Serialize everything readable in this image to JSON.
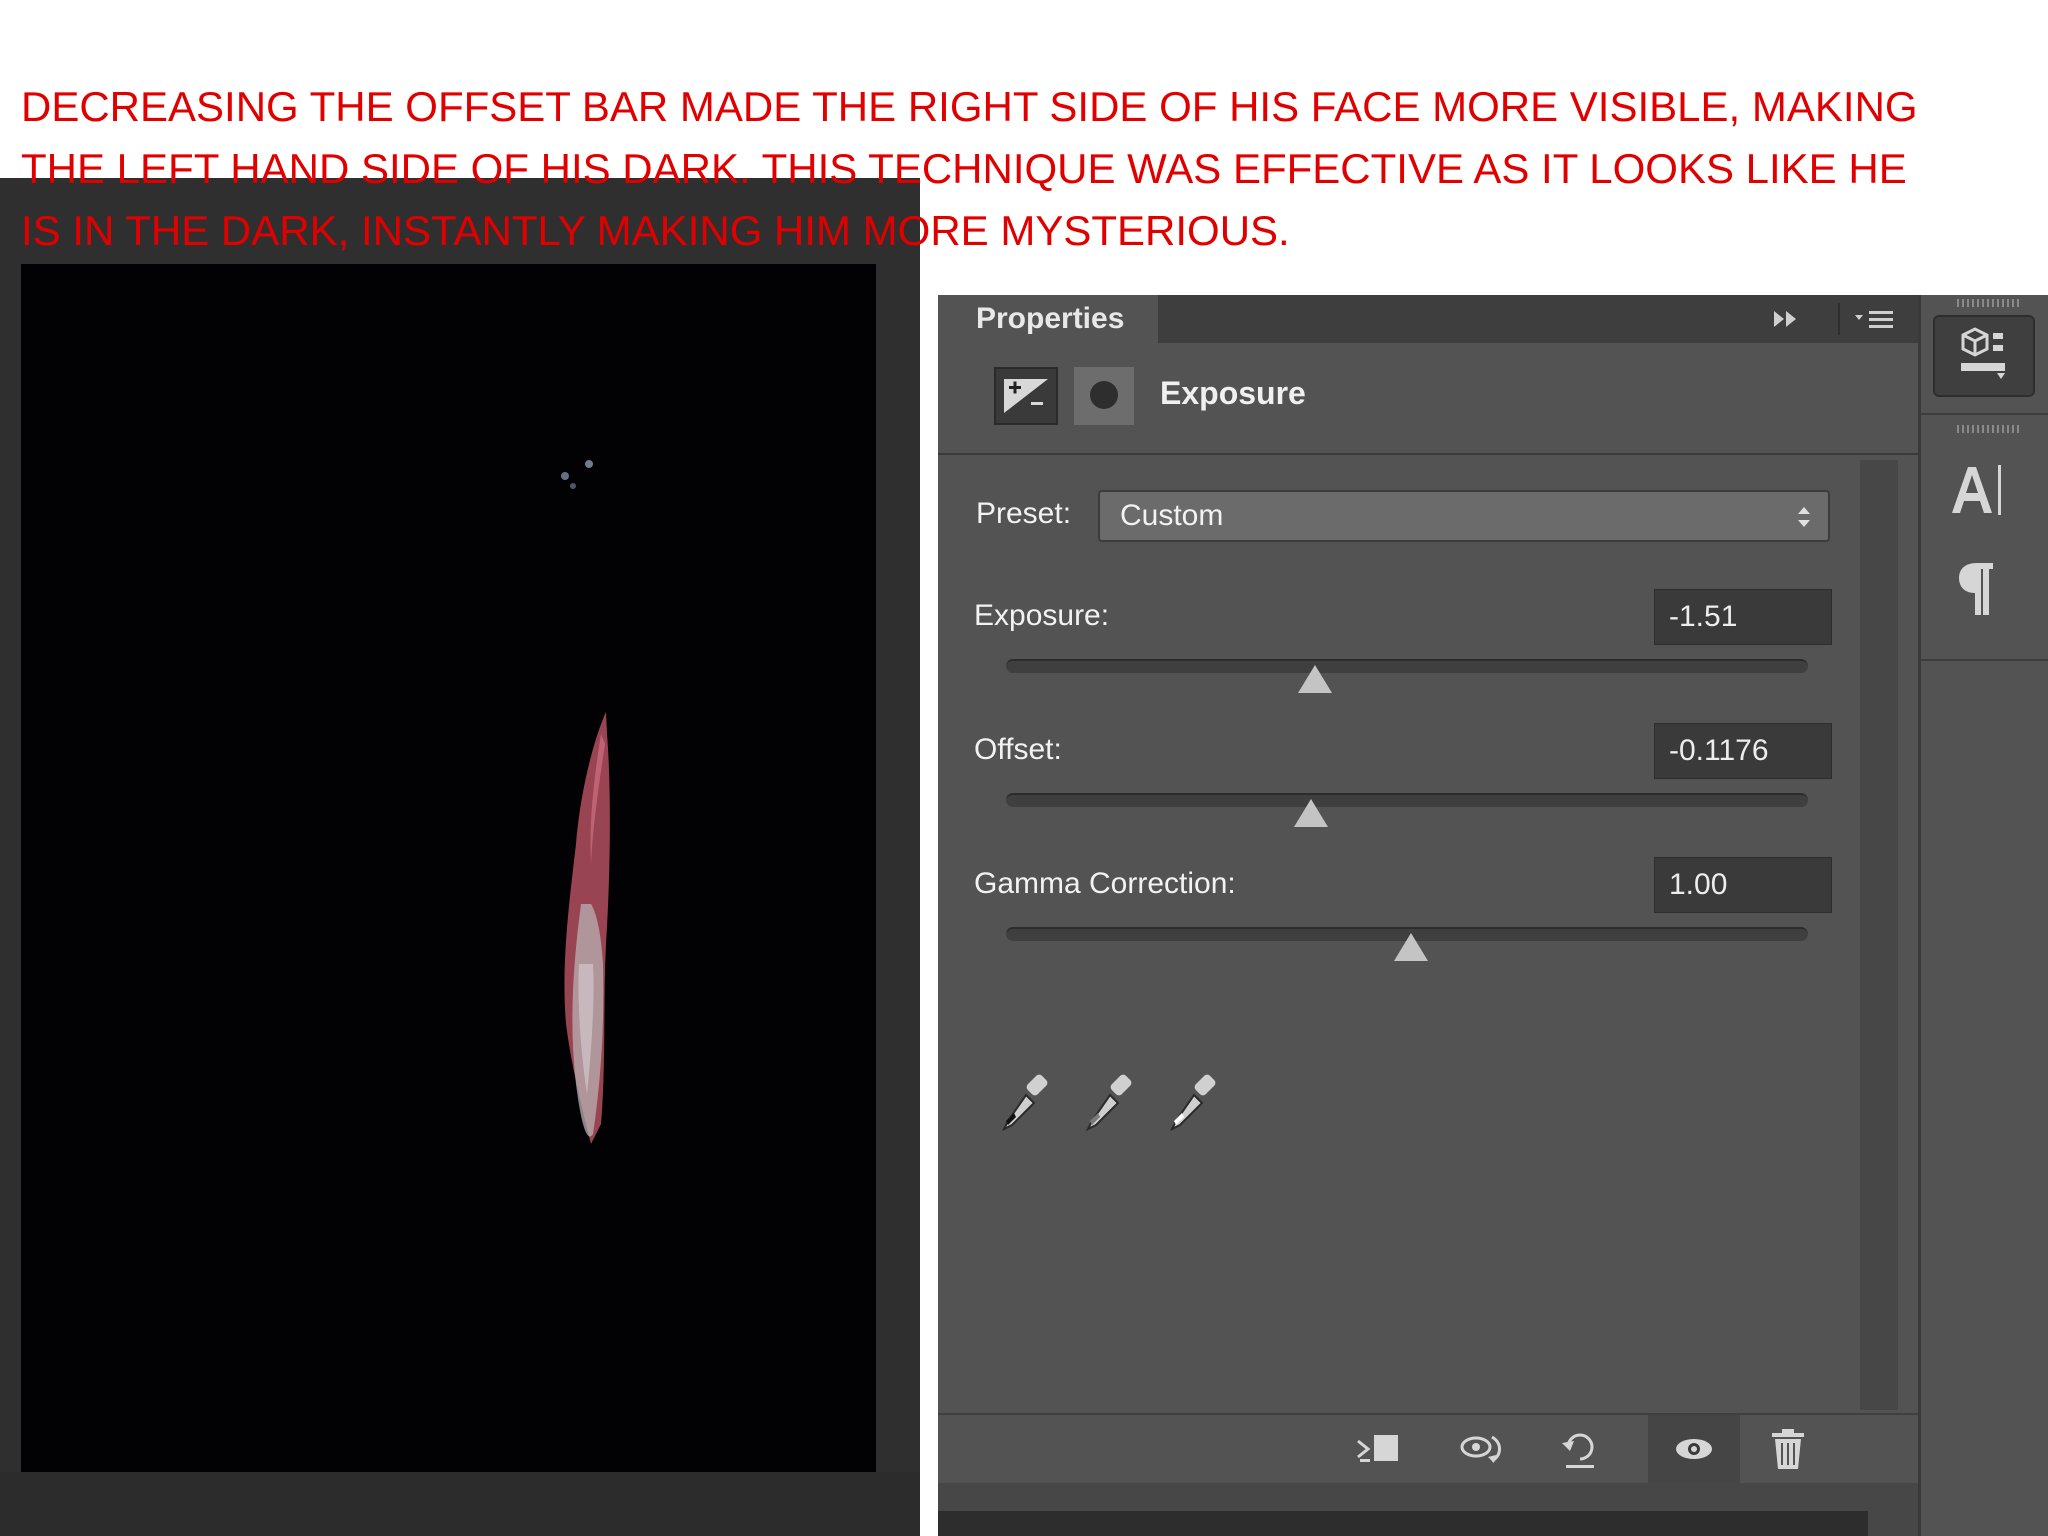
{
  "caption": "DECREASING THE OFFSET BAR MADE THE RIGHT SIDE OF HIS FACE MORE VISIBLE, MAKING THE LEFT HAND SIDE OF HIS DARK. THIS TECHNIQUE WAS EFFECTIVE AS IT LOOKS LIKE HE IS IN THE DARK, INSTANTLY MAKING HIM MORE MYSTERIOUS.",
  "panel": {
    "tab_label": "Properties",
    "adjustment_title": "Exposure",
    "preset_label": "Preset:",
    "preset_value": "Custom",
    "fields": [
      {
        "label": "Exposure:",
        "value": "-1.51",
        "slider_fraction": 0.385
      },
      {
        "label": "Offset:",
        "value": "-0.1176",
        "slider_fraction": 0.38
      },
      {
        "label": "Gamma Correction:",
        "value": "1.00",
        "slider_fraction": 0.505
      }
    ]
  },
  "icons": {
    "header": [
      "collapse-icon",
      "panel-menu-icon"
    ],
    "adjustment": [
      "exposure-adjustment-icon",
      "layer-mask-icon"
    ],
    "eyedroppers": [
      "black-point-eyedropper-icon",
      "gray-point-eyedropper-icon",
      "white-point-eyedropper-icon"
    ],
    "footer": [
      "clip-to-layer-icon",
      "view-previous-state-icon",
      "reset-icon",
      "visibility-eye-icon",
      "trash-icon"
    ],
    "dock": [
      "properties-panel-icon",
      "character-panel-icon",
      "paragraph-panel-icon"
    ]
  },
  "colors": {
    "caption": "#e00000",
    "panel_bg": "#535353",
    "photo_bg": "#020204"
  }
}
